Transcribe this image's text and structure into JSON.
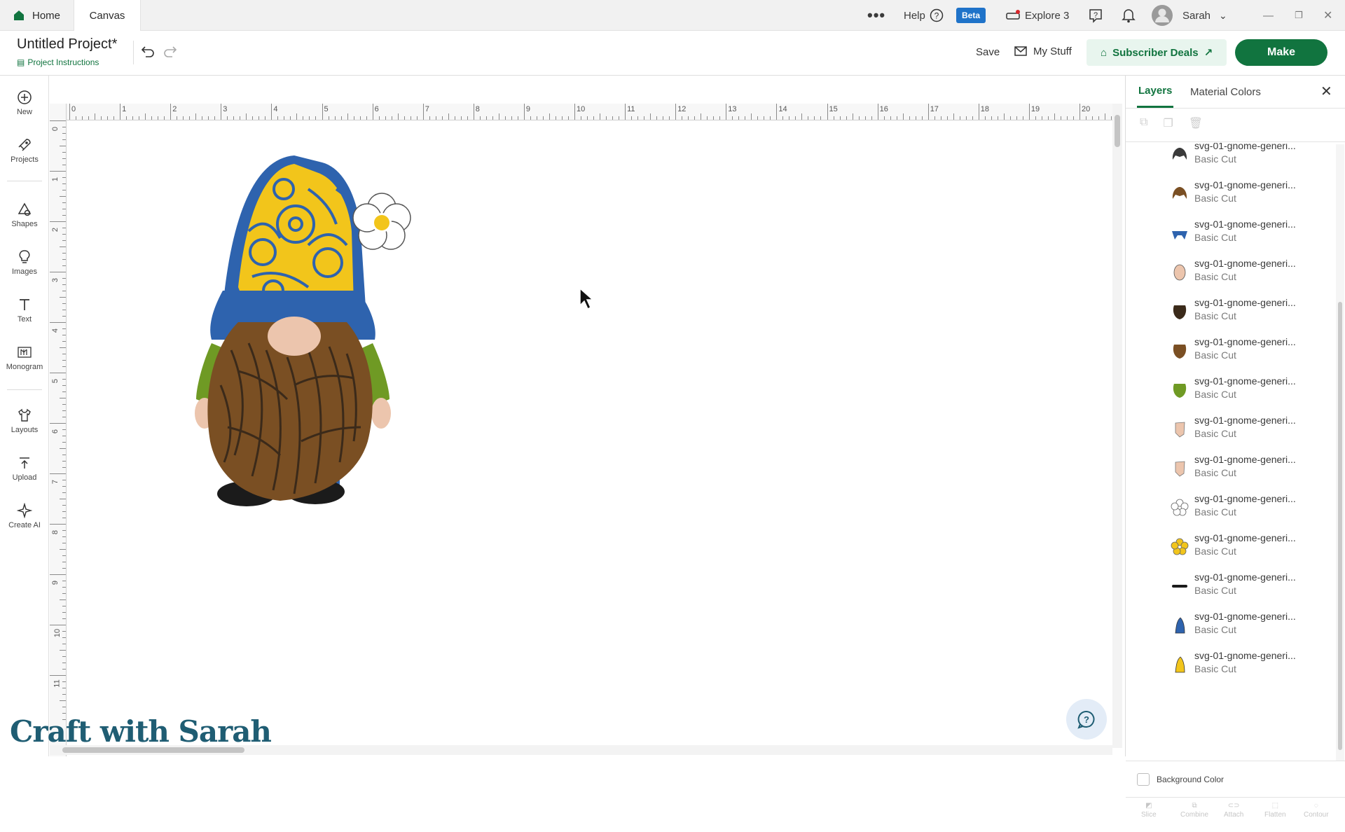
{
  "tabs": {
    "home": "Home",
    "canvas": "Canvas"
  },
  "top_menu": {
    "help": "Help",
    "beta": "Beta",
    "machine": "Explore 3",
    "user": "Sarah"
  },
  "project": {
    "title": "Untitled Project*",
    "instructions": "Project Instructions",
    "save": "Save",
    "my_stuff": "My Stuff",
    "subscriber_deals": "Subscriber Deals",
    "make": "Make"
  },
  "left_tools": [
    {
      "label": "New",
      "icon": "plus-circle-icon"
    },
    {
      "label": "Projects",
      "icon": "rocket-icon"
    },
    {
      "label": "Shapes",
      "icon": "shapes-icon"
    },
    {
      "label": "Images",
      "icon": "lightbulb-icon"
    },
    {
      "label": "Text",
      "icon": "text-icon"
    },
    {
      "label": "Monogram",
      "icon": "monogram-icon"
    },
    {
      "label": "Layouts",
      "icon": "shirt-icon"
    },
    {
      "label": "Upload",
      "icon": "upload-icon"
    },
    {
      "label": "Create AI",
      "icon": "sparkle-icon"
    }
  ],
  "ruler": {
    "top": [
      "0",
      "1",
      "2",
      "3",
      "4",
      "5",
      "6",
      "7",
      "8",
      "9",
      "10",
      "11",
      "12",
      "13",
      "14",
      "15",
      "16",
      "17",
      "18",
      "19",
      "20"
    ],
    "left": [
      "0",
      "1",
      "2",
      "3",
      "4",
      "5",
      "6",
      "7",
      "8",
      "9",
      "10",
      "11"
    ]
  },
  "panel": {
    "tab_layers": "Layers",
    "tab_material": "Material Colors",
    "background_color": "Background Color",
    "layers": [
      {
        "name": "svg-01-gnome-generi...",
        "op": "Basic Cut",
        "color": "#3a3a3a",
        "shape": "hair"
      },
      {
        "name": "svg-01-gnome-generi...",
        "op": "Basic Cut",
        "color": "#7a4f23",
        "shape": "hair"
      },
      {
        "name": "svg-01-gnome-generi...",
        "op": "Basic Cut",
        "color": "#2e63ae",
        "shape": "brim"
      },
      {
        "name": "svg-01-gnome-generi...",
        "op": "Basic Cut",
        "color": "#ecc5ad",
        "shape": "oval"
      },
      {
        "name": "svg-01-gnome-generi...",
        "op": "Basic Cut",
        "color": "#3b2a1a",
        "shape": "beard"
      },
      {
        "name": "svg-01-gnome-generi...",
        "op": "Basic Cut",
        "color": "#7a4f23",
        "shape": "beard"
      },
      {
        "name": "svg-01-gnome-generi...",
        "op": "Basic Cut",
        "color": "#6f9a24",
        "shape": "beard"
      },
      {
        "name": "svg-01-gnome-generi...",
        "op": "Basic Cut",
        "color": "#ecc5ad",
        "shape": "hand"
      },
      {
        "name": "svg-01-gnome-generi...",
        "op": "Basic Cut",
        "color": "#ecc5ad",
        "shape": "hand"
      },
      {
        "name": "svg-01-gnome-generi...",
        "op": "Basic Cut",
        "color": "#ffffff",
        "shape": "flower"
      },
      {
        "name": "svg-01-gnome-generi...",
        "op": "Basic Cut",
        "color": "#f2c51b",
        "shape": "flower"
      },
      {
        "name": "svg-01-gnome-generi...",
        "op": "Basic Cut",
        "color": "#1b1b1b",
        "shape": "bar"
      },
      {
        "name": "svg-01-gnome-generi...",
        "op": "Basic Cut",
        "color": "#2e63ae",
        "shape": "hat"
      },
      {
        "name": "svg-01-gnome-generi...",
        "op": "Basic Cut",
        "color": "#f2c51b",
        "shape": "hat"
      }
    ],
    "bottom_tools": [
      "Slice",
      "Combine",
      "Attach",
      "Flatten",
      "Contour"
    ]
  },
  "watermark": "Craft with Sarah",
  "colors": {
    "accent": "#11743f",
    "beta": "#1f73c9"
  }
}
